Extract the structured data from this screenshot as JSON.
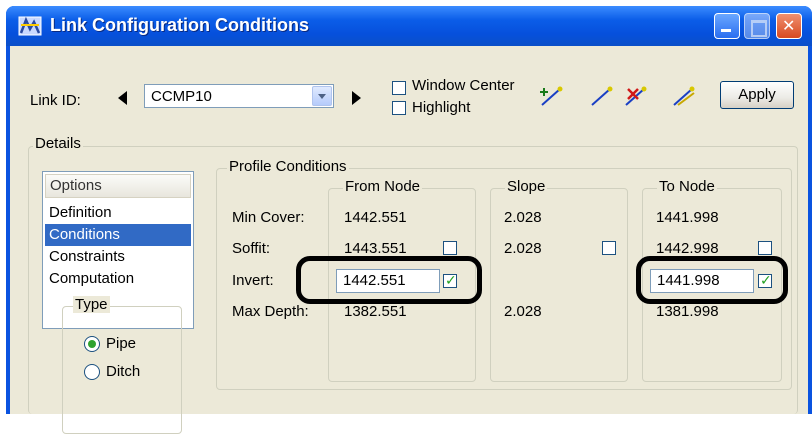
{
  "window": {
    "title": "Link Configuration Conditions"
  },
  "toolbar": {
    "link_id_label": "Link ID:",
    "link_id_value": "CCMP10",
    "window_center_label": "Window Center",
    "window_center_checked": false,
    "highlight_label": "Highlight",
    "highlight_checked": false,
    "apply_label": "Apply",
    "tool_icons": [
      "add-link-icon",
      "select-link-icon",
      "delete-link-icon",
      "edit-link-icon"
    ]
  },
  "details": {
    "label": "Details",
    "options_header": "Options",
    "items": [
      "Definition",
      "Conditions",
      "Constraints",
      "Computation"
    ],
    "selected_item": "Conditions",
    "type_label": "Type",
    "type_options": [
      "Pipe",
      "Ditch"
    ],
    "selected_type": "Pipe"
  },
  "profile": {
    "label": "Profile Conditions",
    "columns": {
      "from_node": "From Node",
      "slope": "Slope",
      "to_node": "To Node"
    },
    "rows": [
      {
        "label": "Min Cover:",
        "from": "1442.551",
        "slope": "2.028",
        "to": "1441.998"
      },
      {
        "label": "Soffit:",
        "from": "1443.551",
        "from_checked": false,
        "slope": "2.028",
        "slope_checked": false,
        "to": "1442.998",
        "to_checked": false
      },
      {
        "label": "Invert:",
        "from": "1442.551",
        "from_checked": true,
        "to": "1441.998",
        "to_checked": true
      },
      {
        "label": "Max Depth:",
        "from": "1382.551",
        "slope": "2.028",
        "to": "1381.998"
      }
    ]
  },
  "colors": {
    "titlebar": "#0b5de8",
    "dialog_bg": "#ece9d8",
    "selection": "#316ac5",
    "check_mark": "#21a121"
  }
}
